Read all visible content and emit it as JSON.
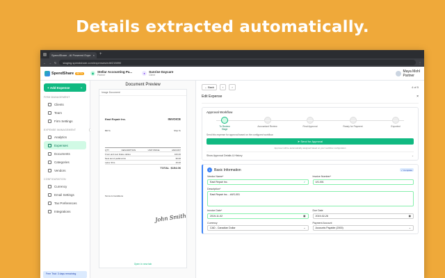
{
  "headline": "Details extracted automatically.",
  "browser": {
    "tab_title": "SpendShare - AI Powered Expe",
    "url": "staging.spendshare.com/expenses/edit/219890"
  },
  "header": {
    "app_name": "SpendShare",
    "badge": "BETA",
    "org1_title": "Stellar Accounting Pa...",
    "org1_sub": "Partner",
    "org2_title": "Sunrise Daycare",
    "org2_sub": "Client",
    "user_name": "Maya Mohl",
    "user_role": "Partner"
  },
  "sidebar": {
    "add_label": "Add Expense",
    "sec1": "FIRM MANAGEMENT",
    "items1": [
      "Clients",
      "Team",
      "Firm Settings"
    ],
    "sec2": "EXPENSE MANAGEMENT",
    "items2": [
      "Analytics",
      "Expenses",
      "Documents",
      "Categories",
      "Vendors"
    ],
    "sec3": "CONFIGURATION",
    "items3": [
      "Currency",
      "Email Settings",
      "Tax Preferences",
      "Integrations"
    ],
    "trial": "Free Trial: 3 days remaining"
  },
  "preview": {
    "title": "Document Preview",
    "tag": "Image Document",
    "company": "East Repair Inc.",
    "invoice_label": "INVOICE",
    "bill_to": "Bill To",
    "ship_to": "Ship To",
    "qty_header": "QTY",
    "desc_header": "DESCRIPTION",
    "price_header": "UNIT PRICE",
    "amount_header": "AMOUNT",
    "line1": "Front and rear brake cables",
    "line1_amt": "100.00",
    "line2": "New set of pedal arms",
    "line2_amt": "30.00",
    "line3": "Labor 3hrs",
    "line3_amt": "15.00",
    "total_label": "TOTAL",
    "total_value": "$154.06",
    "signature": "John Smith",
    "terms": "Terms & Conditions",
    "open_link": "Open in new tab"
  },
  "form": {
    "back": "Back",
    "count": "4 of 5",
    "title": "Edit Expense",
    "close": "×",
    "workflow_title": "Approval Workflow",
    "steps": [
      "To Review",
      "Accountant Review",
      "Final Approval",
      "Ready for Payment",
      "Exported"
    ],
    "step_sub": "Stage",
    "hint": "Send this expense for approval based on the configured workflow.",
    "send_label": "Send for Approval",
    "subhint": "Approver will be automatically assigned based on your workflow configuration",
    "show_details": "Show Approval Details & History",
    "basic_num": "1",
    "basic_title": "Basic Information",
    "basic_badge": "Complete",
    "vendor_label": "Vendor Name*",
    "vendor_value": "East Repair Inc.",
    "invoice_no_label": "Invoice Number*",
    "invoice_no_value": "US-001",
    "desc_label": "Description*",
    "desc_value": "East Repair Inc. - #US-001",
    "invoice_date_label": "Invoice Date*",
    "invoice_date_value": "2019-11-02",
    "due_date_label": "Due Date",
    "due_date_value": "2019-02-26",
    "currency_label": "Currency",
    "currency_value": "CAD - Canadian Dollar",
    "payment_label": "Payment Account",
    "payment_value": "Accounts Payable (2000)"
  }
}
